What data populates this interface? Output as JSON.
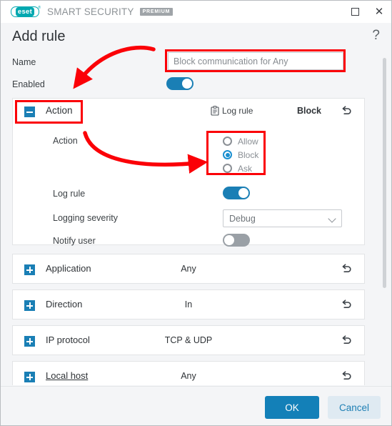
{
  "window": {
    "brand_mark": "eset",
    "product_name": "SMART SECURITY",
    "edition_badge": "PREMIUM",
    "maximize_icon": "maximize-icon",
    "close_icon": "close-icon",
    "accent_color": "#1a7fb5",
    "brand_color": "#00a8b0",
    "annotation_color": "#fb0007"
  },
  "header": {
    "title": "Add rule",
    "help_icon": "?"
  },
  "form": {
    "name_label": "Name",
    "name_value": "Block communication for Any",
    "name_placeholder": "Block communication for Any",
    "enabled_label": "Enabled",
    "enabled_state": "on"
  },
  "action_section": {
    "expanded": true,
    "collapse_icon": "minus-square-icon",
    "title": "Action",
    "log_badge_label": "Log rule",
    "log_badge_icon": "clipboard-icon",
    "summary_value": "Block",
    "revert_icon": "undo-icon",
    "rows": {
      "action_label": "Action",
      "action_options": [
        {
          "label": "Allow",
          "selected": false
        },
        {
          "label": "Block",
          "selected": true
        },
        {
          "label": "Ask",
          "selected": false
        }
      ],
      "log_rule_label": "Log rule",
      "log_rule_state": "on",
      "logging_severity_label": "Logging severity",
      "logging_severity_value": "Debug",
      "notify_user_label": "Notify user",
      "notify_user_state": "off"
    }
  },
  "collapsed_sections": [
    {
      "expand_icon": "plus-square-icon",
      "title": "Application",
      "value": "Any",
      "revert_icon": "undo-icon",
      "underlined": false
    },
    {
      "expand_icon": "plus-square-icon",
      "title": "Direction",
      "value": "In",
      "revert_icon": "undo-icon",
      "underlined": false
    },
    {
      "expand_icon": "plus-square-icon",
      "title": "IP protocol",
      "value": "TCP & UDP",
      "revert_icon": "undo-icon",
      "underlined": false
    },
    {
      "expand_icon": "plus-square-icon",
      "title": "Local host",
      "value": "Any",
      "revert_icon": "undo-icon",
      "underlined": true
    }
  ],
  "footer": {
    "ok_label": "OK",
    "cancel_label": "Cancel"
  }
}
